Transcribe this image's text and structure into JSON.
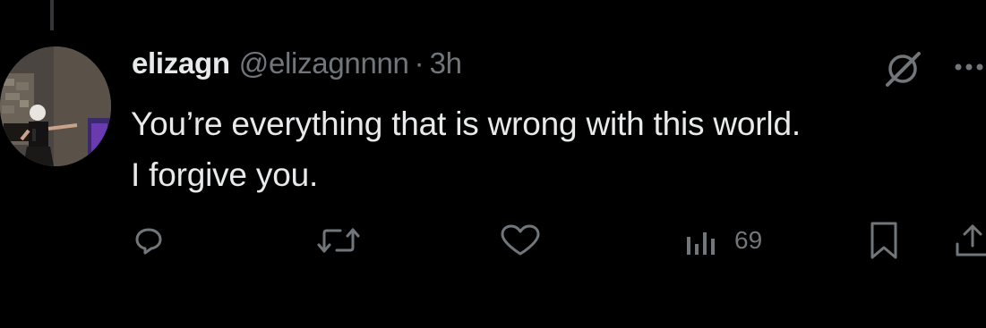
{
  "post": {
    "display_name": "elizagn",
    "handle": "@elizagnnnn",
    "separator": "·",
    "time": "3h",
    "text_lines": [
      "You’re everything that is wrong with this world.",
      "I forgive you."
    ]
  },
  "actions": {
    "reply_icon": "reply-icon",
    "repost_icon": "repost-icon",
    "like_icon": "heart-icon",
    "views_icon": "views-chart-icon",
    "views_count": "69",
    "bookmark_icon": "bookmark-icon",
    "share_icon": "share-icon"
  },
  "icons": {
    "grok": "grok-icon",
    "more": "more-icon"
  },
  "colors": {
    "background": "#000000",
    "primary_text": "#e7e9ea",
    "secondary_text": "#71767b",
    "thread_line": "#333639"
  }
}
